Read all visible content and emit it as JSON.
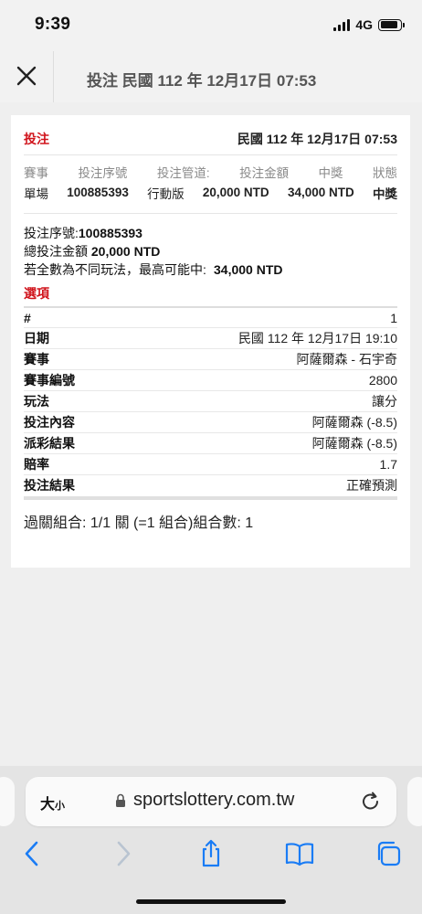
{
  "status_bar": {
    "time": "9:39",
    "network": "4G"
  },
  "header": {
    "title": "投注 民國 112 年 12月17日 07:53"
  },
  "card": {
    "title": "投注",
    "date": "民國 112 年 12月17日 07:53",
    "summary": {
      "labels": [
        "賽事",
        "投注序號",
        "投注管道:",
        "投注金額",
        "中獎",
        "狀態"
      ],
      "values": [
        "單場",
        "100885393",
        "行動版",
        "20,000 NTD",
        "34,000 NTD",
        "中獎"
      ]
    },
    "details": {
      "serial_label": "投注序號:",
      "serial_value": "100885393",
      "total_label": "總投注金額",
      "total_value": "20,000 NTD",
      "max_label": "若全數為不同玩法，最高可能中:",
      "max_value": "34,000 NTD"
    },
    "options_title": "選項",
    "options": [
      {
        "key": "#",
        "value": "1"
      },
      {
        "key": "日期",
        "value": "民國 112 年 12月17日 19:10"
      },
      {
        "key": "賽事",
        "value": "阿薩爾森 - 石宇奇"
      },
      {
        "key": "賽事編號",
        "value": "2800"
      },
      {
        "key": "玩法",
        "value": "讓分"
      },
      {
        "key": "投注內容",
        "value": "阿薩爾森 (-8.5)"
      },
      {
        "key": "派彩結果",
        "value": "阿薩爾森 (-8.5)"
      },
      {
        "key": "賠率",
        "value": "1.7"
      },
      {
        "key": "投注結果",
        "value": "正確預測"
      }
    ],
    "parlay": "過關組合: 1/1 關 (=1 組合)組合數: 1"
  },
  "browser": {
    "text_size_label": "大",
    "text_size_small": "小",
    "url": "sportslottery.com.tw"
  },
  "colors": {
    "accent_red": "#d0131b",
    "ios_blue": "#1a7cf5"
  }
}
